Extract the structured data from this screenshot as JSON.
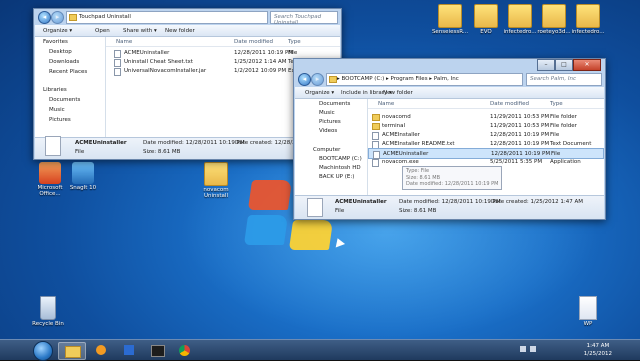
{
  "desktop": {
    "icons": [
      {
        "label": "Microsoft Office..."
      },
      {
        "label": "SnagIt 10"
      },
      {
        "label": "novacom Uninstall"
      },
      {
        "label": "Recycle Bin"
      },
      {
        "label": "WP"
      },
      {
        "label": "SenseiessR..."
      },
      {
        "label": "EVO"
      },
      {
        "label": "infectedro..."
      },
      {
        "label": "roeteyo3d..."
      },
      {
        "label": "infectedro..."
      }
    ]
  },
  "win1": {
    "address": "Touchpad Uninstall",
    "search_placeholder": "Search Touchpad Uninstall",
    "toolbar": {
      "organize": "Organize ▾",
      "open": "Open",
      "share": "Share with ▾",
      "new_folder": "New folder"
    },
    "sidebar": {
      "favorites": "Favorites",
      "desktop": "Desktop",
      "downloads": "Downloads",
      "recent": "Recent Places",
      "libraries": "Libraries",
      "documents": "Documents",
      "music": "Music",
      "pictures": "Pictures"
    },
    "columns": {
      "name": "Name",
      "date": "Date modified",
      "type": "Type"
    },
    "files": [
      {
        "name": "ACMEUninstaller",
        "date": "12/28/2011 10:19 PM",
        "type": "File"
      },
      {
        "name": "Uninstall Cheat Sheet.txt",
        "date": "1/25/2012 1:14 AM",
        "type": "Te"
      },
      {
        "name": "UniversalNovacomInstaller.jar",
        "date": "1/2/2012 10:09 PM",
        "type": "Ex"
      }
    ],
    "details": {
      "name": "ACMEUninstaller",
      "modified_label": "Date modified: 12/28/2011 10:19 PM",
      "created_label": "Date created: 12/28/2011 10:19 PM",
      "type": "File",
      "size": "Size: 8.61 MB"
    }
  },
  "win2": {
    "address": "▸ BOOTCAMP (C:) ▸ Program Files ▸ Palm, Inc",
    "search_placeholder": "Search Palm, Inc",
    "toolbar": {
      "organize": "Organize ▾",
      "include": "Include in library ▾",
      "new_folder": "New folder"
    },
    "sidebar": {
      "documents": "Documents",
      "music": "Music",
      "pictures": "Pictures",
      "videos": "Videos",
      "computer": "Computer",
      "bootcamp": "BOOTCAMP (C:)",
      "machintosh": "Machintosh HD",
      "backup": "BACK UP (E:)"
    },
    "columns": {
      "name": "Name",
      "date": "Date modified",
      "type": "Type"
    },
    "files": [
      {
        "name": "novacomd",
        "date": "11/29/2011 10:53 PM",
        "type": "File folder",
        "kind": "folder"
      },
      {
        "name": "terminal",
        "date": "11/29/2011 10:53 PM",
        "type": "File folder",
        "kind": "folder"
      },
      {
        "name": "ACMEInstaller",
        "date": "12/28/2011 10:19 PM",
        "type": "File",
        "kind": "file"
      },
      {
        "name": "ACMEInstaller README.txt",
        "date": "12/28/2011 10:19 PM",
        "type": "Text Document",
        "kind": "file"
      },
      {
        "name": "ACMEUninstaller",
        "date": "12/28/2011 10:19 PM",
        "type": "File",
        "kind": "file"
      },
      {
        "name": "novacom.exe",
        "date": "5/25/2011 5:35 PM",
        "type": "Application",
        "kind": "file"
      }
    ],
    "tooltip": {
      "line1": "Type: File",
      "line2": "Size: 8.61 MB",
      "line3": "Date modified: 12/28/2011 10:19 PM"
    },
    "details": {
      "name": "ACMEUninstaller",
      "modified_label": "Date modified: 12/28/2011 10:19 PM",
      "created_label": "Date created: 1/25/2012 1:47 AM",
      "type": "File",
      "size": "Size: 8.61 MB"
    }
  },
  "taskbar": {
    "time": "1:47 AM",
    "date": "1/25/2012"
  }
}
